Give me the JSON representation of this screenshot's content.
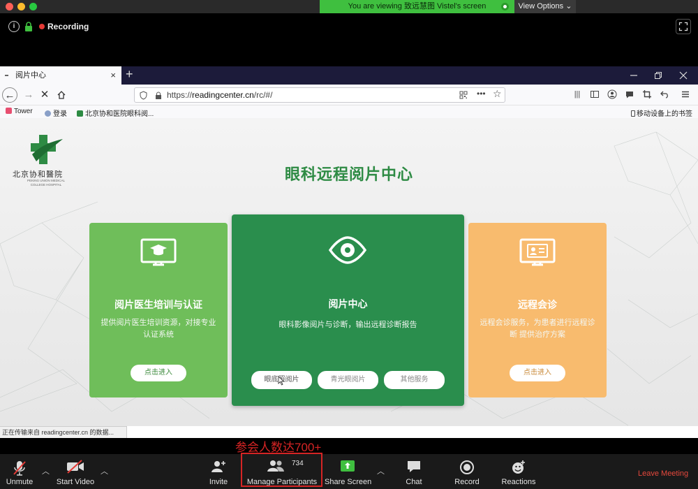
{
  "zoom": {
    "share_banner": "You are viewing 致远慧图 Vistel's screen",
    "view_options": "View Options",
    "recording": "Recording",
    "toolbar": {
      "unmute": "Unmute",
      "start_video": "Start Video",
      "invite": "Invite",
      "participants_count": "734",
      "manage_participants": "Manage Participants",
      "share_screen": "Share Screen",
      "chat": "Chat",
      "record": "Record",
      "reactions": "Reactions",
      "leave_meeting": "Leave Meeting"
    },
    "annotation": "参会人数达700+"
  },
  "browser": {
    "tab_title": "阅片中心",
    "tab_close": "×",
    "new_tab": "+",
    "url_prefix": "https://",
    "url_host": "readingcenter.cn",
    "url_path": "/rc/#/",
    "bookmarks": [
      "Tower",
      "登录",
      "北京协和医院眼科阅..."
    ],
    "mobile_bookmarks": "移动设备上的书签",
    "status": "正在传输来自 readingcenter.cn 的数据...",
    "icons": [
      "back-icon",
      "forward-icon",
      "stop-icon",
      "home-icon",
      "shield-icon",
      "lock-icon",
      "qr-icon",
      "more-icon",
      "star-icon",
      "library-icon",
      "sidebar-icon",
      "account-icon",
      "chat-icon",
      "crop-icon",
      "undo-icon",
      "menu-icon"
    ]
  },
  "page": {
    "logo_name": "北京协和醫院",
    "logo_sub": "PEKING UNION MEDICAL COLLEGE HOSPITAL",
    "title": "眼科远程阅片中心",
    "cards": [
      {
        "title": "阅片医生培训与认证",
        "desc": "提供阅片医生培训资源，对接专业 认证系统",
        "button": "点击进入",
        "icon": "monitor-graduation-icon"
      },
      {
        "title": "阅片中心",
        "desc": "眼科影像阅片与诊断，输出远程诊断报告",
        "buttons": [
          "眼底照阅片",
          "青光眼阅片",
          "其他服务"
        ],
        "icon": "eye-icon"
      },
      {
        "title": "远程会诊",
        "desc": "远程会诊服务，为患者进行远程诊断 提供治疗方案",
        "button": "点击进入",
        "icon": "monitor-id-card-icon"
      }
    ],
    "colors": {
      "title_green": "#2e8b44",
      "card_left": "#6fbe5a",
      "card_mid": "#2a8e4d",
      "card_right": "#f8bb6e"
    }
  }
}
